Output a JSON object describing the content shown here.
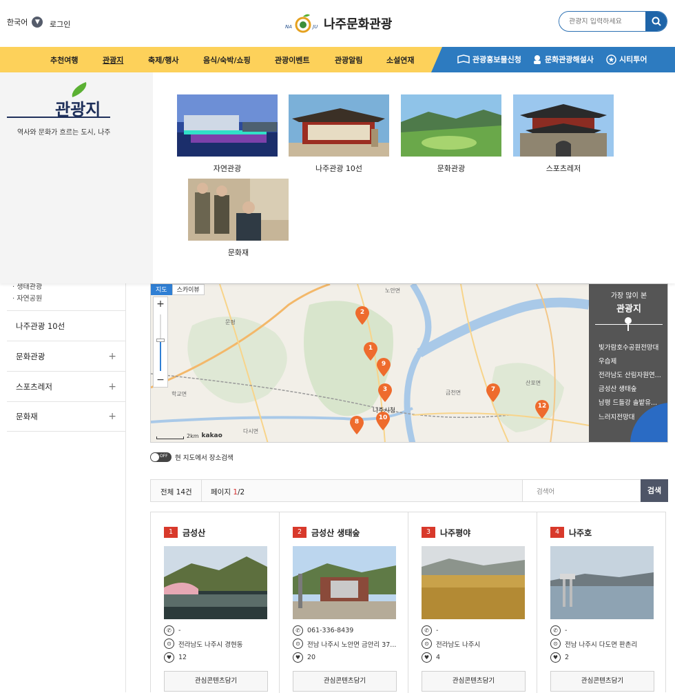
{
  "header": {
    "language": "한국어",
    "login": "로그인",
    "logo_title": "나주문화관광",
    "logo_mark_text": "NA JU",
    "search_placeholder": "관광지 입력하세요"
  },
  "nav": {
    "items": [
      "추천여행",
      "관광지",
      "축제/행사",
      "음식/숙박/쇼핑",
      "관광이벤트",
      "관광알림",
      "소설연재"
    ],
    "active_index": 1,
    "blue_items": [
      "관광홍보물신청",
      "문화관광해설사",
      "시티투어"
    ]
  },
  "mega_menu": {
    "heading": "관광지",
    "subtitle": "역사와 문화가 흐르는 도시, 나주",
    "cards": [
      {
        "label": "자연관광"
      },
      {
        "label": "나주관광 10선"
      },
      {
        "label": "문화관광"
      },
      {
        "label": "스포츠레저"
      },
      {
        "label": "문화재"
      }
    ]
  },
  "sidebar": {
    "sub_items": [
      "· 생태관광",
      "· 자연공원"
    ],
    "menus": [
      {
        "label": "나주관광 10선",
        "expandable": false
      },
      {
        "label": "문화관광",
        "expandable": true
      },
      {
        "label": "스포츠레저",
        "expandable": true
      },
      {
        "label": "문화재",
        "expandable": true
      }
    ]
  },
  "map": {
    "view_tabs": [
      "지도",
      "스카이뷰"
    ],
    "zoom_in": "+",
    "zoom_out": "−",
    "scale_label": "2km",
    "provider": "kakao",
    "city_label": "나주시청",
    "place_labels": [
      "노안면",
      "문평",
      "학교면",
      "금천면",
      "산포면",
      "다시면"
    ],
    "markers": [
      "2",
      "1",
      "9",
      "3",
      "7",
      "12",
      "8",
      "10"
    ],
    "popular": {
      "heading_small": "가장 많이 본",
      "heading": "관광지",
      "items": [
        "빛가람호수공원전망대",
        "우습제",
        "전라남도 산림자원연...",
        "금성산 생태숲",
        "남평 드들강 솔밭유...",
        "느러지전망대"
      ]
    }
  },
  "map_toggle": {
    "state": "OFF",
    "label": "현 지도에서 장소검색"
  },
  "results": {
    "total": "전체 14건",
    "page_prefix": "페이지 ",
    "page_current": "1",
    "page_total": "/2",
    "search_placeholder": "검색어",
    "search_button": "검색"
  },
  "places": [
    {
      "num": "1",
      "name": "금성산",
      "phone": "-",
      "address": "전라남도 나주시 경현동",
      "likes": "12",
      "button": "관심콘텐츠담기"
    },
    {
      "num": "2",
      "name": "금성산 생태숲",
      "phone": "061-336-8439",
      "address": "전남 나주시 노안면 금안리 37...",
      "likes": "20",
      "button": "관심콘텐츠담기"
    },
    {
      "num": "3",
      "name": "나주평야",
      "phone": "-",
      "address": "전라남도 나주시",
      "likes": "4",
      "button": "관심콘텐츠담기"
    },
    {
      "num": "4",
      "name": "나주호",
      "phone": "-",
      "address": "전남 나주시 다도면 판촌리",
      "likes": "2",
      "button": "관심콘텐츠담기"
    }
  ],
  "colors": {
    "nav_yellow": "#fdd15a",
    "nav_blue": "#2d7bc0",
    "marker_orange": "#ee6b2d",
    "number_red": "#d8392b"
  }
}
